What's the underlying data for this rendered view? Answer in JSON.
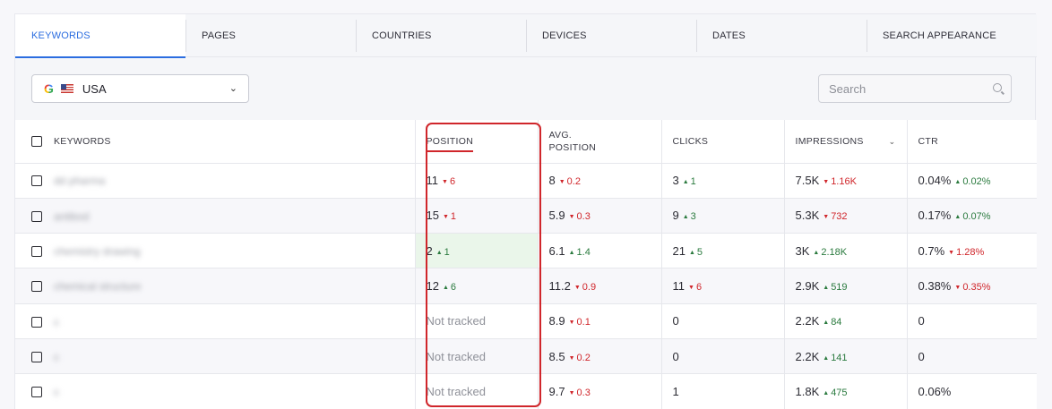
{
  "tabs": [
    {
      "label": "KEYWORDS",
      "active": true
    },
    {
      "label": "PAGES",
      "active": false
    },
    {
      "label": "COUNTRIES",
      "active": false
    },
    {
      "label": "DEVICES",
      "active": false
    },
    {
      "label": "DATES",
      "active": false
    },
    {
      "label": "SEARCH APPEARANCE",
      "active": false
    }
  ],
  "country_select": {
    "engine_icon": "google-icon",
    "flag_icon": "us-flag-icon",
    "value": "USA"
  },
  "search": {
    "placeholder": "Search"
  },
  "columns": {
    "keywords": "KEYWORDS",
    "position": "POSITION",
    "avg_position_1": "AVG.",
    "avg_position_2": "POSITION",
    "clicks": "CLICKS",
    "impressions": "IMPRESSIONS",
    "ctr": "CTR"
  },
  "colors": {
    "accent": "#2b6de0",
    "up": "#2a7a3e",
    "down": "#d0262b",
    "highlight_box": "#d0262b"
  },
  "rows": [
    {
      "keyword": "dd pharma",
      "position": {
        "value": "11",
        "delta": "6",
        "dir": "down"
      },
      "avg_position": {
        "value": "8",
        "delta": "0.2",
        "dir": "down"
      },
      "clicks": {
        "value": "3",
        "delta": "1",
        "dir": "up"
      },
      "impressions": {
        "value": "7.5K",
        "delta": "1.16K",
        "dir": "down"
      },
      "ctr": {
        "value": "0.04%",
        "delta": "0.02%",
        "dir": "up"
      }
    },
    {
      "keyword": "antibod",
      "position": {
        "value": "15",
        "delta": "1",
        "dir": "down"
      },
      "avg_position": {
        "value": "5.9",
        "delta": "0.3",
        "dir": "down"
      },
      "clicks": {
        "value": "9",
        "delta": "3",
        "dir": "up"
      },
      "impressions": {
        "value": "5.3K",
        "delta": "732",
        "dir": "down"
      },
      "ctr": {
        "value": "0.17%",
        "delta": "0.07%",
        "dir": "up"
      }
    },
    {
      "keyword": "chemistry drawing",
      "position": {
        "value": "2",
        "delta": "1",
        "dir": "up",
        "highlight": true
      },
      "avg_position": {
        "value": "6.1",
        "delta": "1.4",
        "dir": "up"
      },
      "clicks": {
        "value": "21",
        "delta": "5",
        "dir": "up"
      },
      "impressions": {
        "value": "3K",
        "delta": "2.18K",
        "dir": "up"
      },
      "ctr": {
        "value": "0.7%",
        "delta": "1.28%",
        "dir": "down"
      }
    },
    {
      "keyword": "chemical structure",
      "position": {
        "value": "12",
        "delta": "6",
        "dir": "up"
      },
      "avg_position": {
        "value": "11.2",
        "delta": "0.9",
        "dir": "down"
      },
      "clicks": {
        "value": "11",
        "delta": "6",
        "dir": "down"
      },
      "impressions": {
        "value": "2.9K",
        "delta": "519",
        "dir": "up"
      },
      "ctr": {
        "value": "0.38%",
        "delta": "0.35%",
        "dir": "down"
      }
    },
    {
      "keyword": "c",
      "position": {
        "value": "Not tracked"
      },
      "avg_position": {
        "value": "8.9",
        "delta": "0.1",
        "dir": "down"
      },
      "clicks": {
        "value": "0"
      },
      "impressions": {
        "value": "2.2K",
        "delta": "84",
        "dir": "up"
      },
      "ctr": {
        "value": "0"
      }
    },
    {
      "keyword": "c",
      "position": {
        "value": "Not tracked"
      },
      "avg_position": {
        "value": "8.5",
        "delta": "0.2",
        "dir": "down"
      },
      "clicks": {
        "value": "0"
      },
      "impressions": {
        "value": "2.2K",
        "delta": "141",
        "dir": "up"
      },
      "ctr": {
        "value": "0"
      }
    },
    {
      "keyword": "c",
      "position": {
        "value": "Not tracked"
      },
      "avg_position": {
        "value": "9.7",
        "delta": "0.3",
        "dir": "down"
      },
      "clicks": {
        "value": "1"
      },
      "impressions": {
        "value": "1.8K",
        "delta": "475",
        "dir": "up"
      },
      "ctr": {
        "value": "0.06%"
      }
    }
  ]
}
